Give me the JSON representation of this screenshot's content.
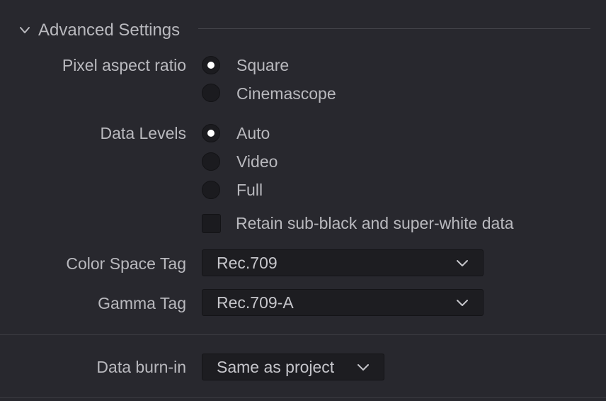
{
  "section": {
    "title": "Advanced Settings",
    "expanded": true
  },
  "pixel_aspect": {
    "label": "Pixel aspect ratio",
    "options": [
      {
        "label": "Square",
        "selected": true
      },
      {
        "label": "Cinemascope",
        "selected": false
      }
    ]
  },
  "data_levels": {
    "label": "Data Levels",
    "options": [
      {
        "label": "Auto",
        "selected": true
      },
      {
        "label": "Video",
        "selected": false
      },
      {
        "label": "Full",
        "selected": false
      }
    ],
    "retain_label": "Retain sub-black and super-white data",
    "retain_checked": false
  },
  "color_space": {
    "label": "Color Space Tag",
    "value": "Rec.709"
  },
  "gamma": {
    "label": "Gamma Tag",
    "value": "Rec.709-A"
  },
  "burn_in": {
    "label": "Data burn-in",
    "value": "Same as project"
  },
  "icons": {
    "section_toggle": "chevron-down-icon",
    "dropdown_caret": "chevron-down-icon"
  },
  "colors": {
    "background": "#28282e",
    "text": "#b9b9be",
    "control_bg": "#1b1b1f",
    "radio_selected_dot": "#ffffff"
  }
}
